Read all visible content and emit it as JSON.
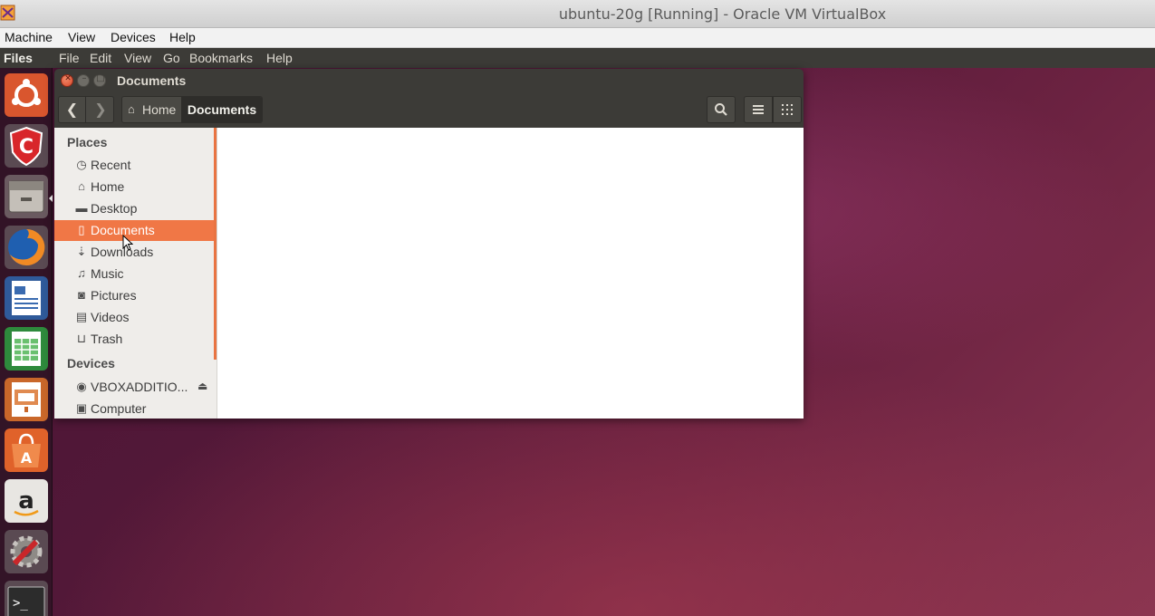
{
  "vbox": {
    "title": "ubuntu-20g [Running] - Oracle VM VirtualBox",
    "menu": [
      "Machine",
      "View",
      "Devices",
      "Help"
    ]
  },
  "topbar": {
    "app_name": "Files",
    "menu": [
      "File",
      "Edit",
      "View",
      "Go",
      "Bookmarks",
      "Help"
    ]
  },
  "launcher": {
    "items": [
      "ubuntu-dash-icon",
      "comodo-antivirus-icon",
      "files-icon",
      "firefox-icon",
      "libreoffice-writer-icon",
      "libreoffice-calc-icon",
      "libreoffice-impress-icon",
      "ubuntu-software-center-icon",
      "amazon-icon",
      "system-settings-icon",
      "terminal-icon"
    ]
  },
  "window": {
    "title": "Documents",
    "path": {
      "home_label": "Home",
      "current_label": "Documents"
    }
  },
  "sidebar": {
    "places_heading": "Places",
    "places": [
      {
        "label": "Recent",
        "icon": "clock-icon"
      },
      {
        "label": "Home",
        "icon": "home-icon"
      },
      {
        "label": "Desktop",
        "icon": "folder-icon"
      },
      {
        "label": "Documents",
        "icon": "document-icon",
        "selected": true
      },
      {
        "label": "Downloads",
        "icon": "download-icon"
      },
      {
        "label": "Music",
        "icon": "music-icon"
      },
      {
        "label": "Pictures",
        "icon": "camera-icon"
      },
      {
        "label": "Videos",
        "icon": "film-icon"
      },
      {
        "label": "Trash",
        "icon": "trash-icon"
      }
    ],
    "devices_heading": "Devices",
    "devices": [
      {
        "label": "VBOXADDITIO...",
        "icon": "disc-icon"
      },
      {
        "label": "Computer",
        "icon": "drive-icon"
      }
    ]
  },
  "colors": {
    "accent": "#f07746",
    "panel": "#3c3b37"
  }
}
